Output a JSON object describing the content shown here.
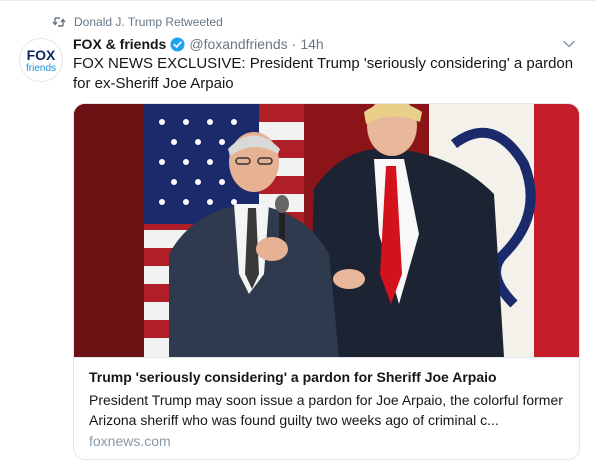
{
  "retweet": {
    "icon": "retweet-icon",
    "text": "Donald J. Trump Retweeted"
  },
  "tweet": {
    "avatar": {
      "icon": "fox-friends-logo",
      "logo_text_top": "FOX",
      "logo_text_bottom": "friends"
    },
    "display_name": "FOX & friends",
    "verified_icon": "verified-badge-icon",
    "handle": "@foxandfriends",
    "separator": "·",
    "time": "14h",
    "menu_icon": "chevron-down-icon",
    "text": "FOX NEWS EXCLUSIVE: President Trump 'seriously considering' a pardon for ex-Sheriff Joe Arpaio"
  },
  "card": {
    "image": "photo-two-men-flags",
    "title": "Trump 'seriously considering' a pardon for Sheriff Joe Arpaio",
    "description": "President Trump may soon issue a pardon for Joe Arpaio, the colorful former Arizona sheriff who was found guilty two weeks ago of criminal c...",
    "domain": "foxnews.com"
  },
  "colors": {
    "text_primary": "#14171a",
    "text_secondary": "#657786",
    "verified_blue": "#1da1f2",
    "border": "#e1e8ed",
    "domain_gray": "#8899a6"
  }
}
